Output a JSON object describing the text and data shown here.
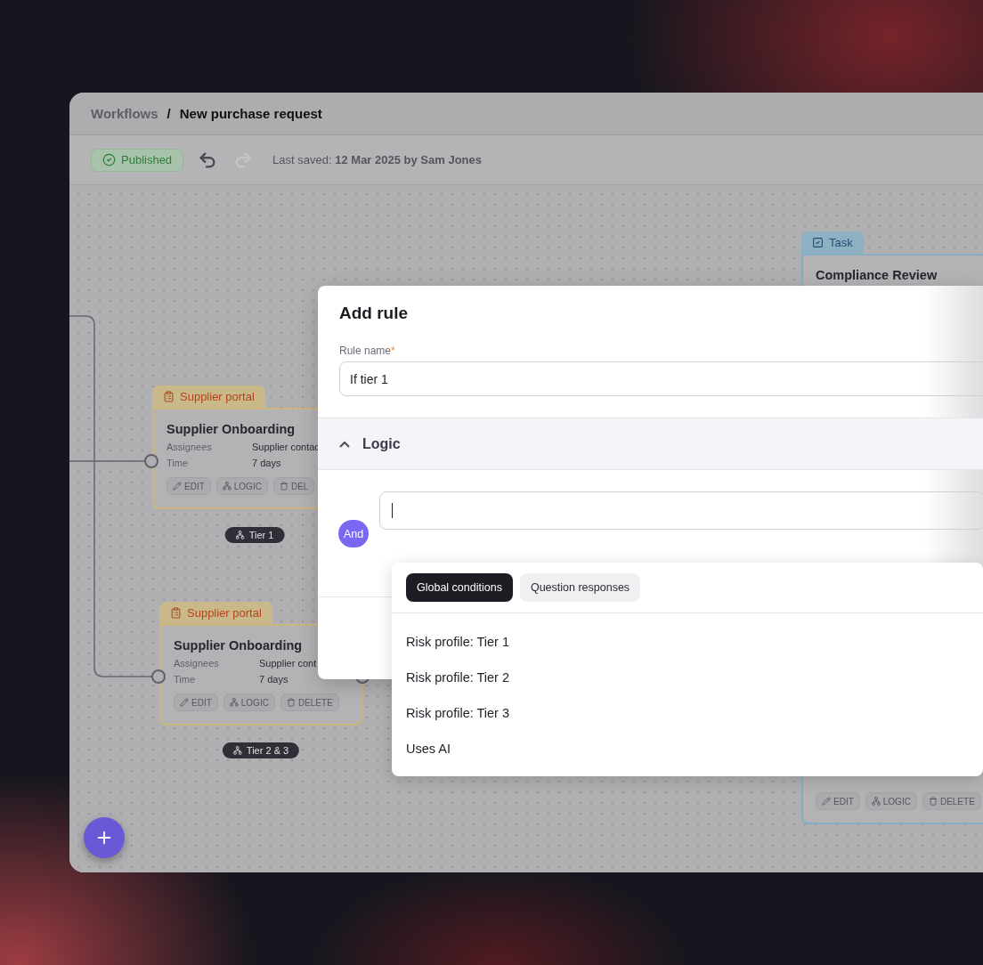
{
  "breadcrumb": {
    "parent": "Workflows",
    "separator": "/",
    "current": "New purchase request"
  },
  "toolbar": {
    "status": "Published",
    "history": [
      {
        "kind": "undo",
        "disabled": false
      },
      {
        "kind": "redo",
        "disabled": true
      }
    ],
    "last_saved_label": "Last saved:",
    "last_saved_value": "12 Mar 2025 by Sam Jones"
  },
  "canvas": {
    "nodes": [
      {
        "kind": "supplier_portal",
        "tag": "Supplier portal",
        "title": "Supplier Onboarding",
        "fields": [
          {
            "label": "Assignees",
            "value": "Supplier contac"
          },
          {
            "label": "Time",
            "value": "7 days"
          }
        ],
        "actions": [
          {
            "kind": "edit",
            "label": "EDIT"
          },
          {
            "kind": "logic",
            "label": "LOGIC"
          },
          {
            "kind": "delete",
            "label": "DEL"
          }
        ]
      },
      {
        "kind": "supplier_portal",
        "tag": "Supplier portal",
        "title": "Supplier Onboarding",
        "fields": [
          {
            "label": "Assignees",
            "value": "Supplier cont"
          },
          {
            "label": "Time",
            "value": "7 days"
          }
        ],
        "actions": [
          {
            "kind": "edit",
            "label": "EDIT"
          },
          {
            "kind": "logic",
            "label": "LOGIC"
          },
          {
            "kind": "delete",
            "label": "DELETE"
          }
        ]
      },
      {
        "kind": "task",
        "tag": "Task",
        "title": "Compliance Review",
        "actions": [
          {
            "kind": "edit",
            "label": "EDIT"
          },
          {
            "kind": "logic",
            "label": "LOGIC"
          },
          {
            "kind": "delete",
            "label": "DELETE"
          }
        ]
      }
    ],
    "branch_labels": [
      "Tier 1",
      "Tier 2 & 3"
    ]
  },
  "modal": {
    "title": "Add rule",
    "field": {
      "label": "Rule name",
      "required_mark": "*",
      "value": "If tier 1"
    },
    "section": {
      "title": "Logic",
      "expanded": true
    },
    "condition": {
      "operator": "And"
    },
    "dropdown": {
      "tabs": [
        {
          "label": "Global conditions",
          "selected": true
        },
        {
          "label": "Question responses",
          "selected": false
        }
      ],
      "options": [
        "Risk profile: Tier 1",
        "Risk profile: Tier 2",
        "Risk profile: Tier 3",
        "Uses AI"
      ]
    }
  }
}
